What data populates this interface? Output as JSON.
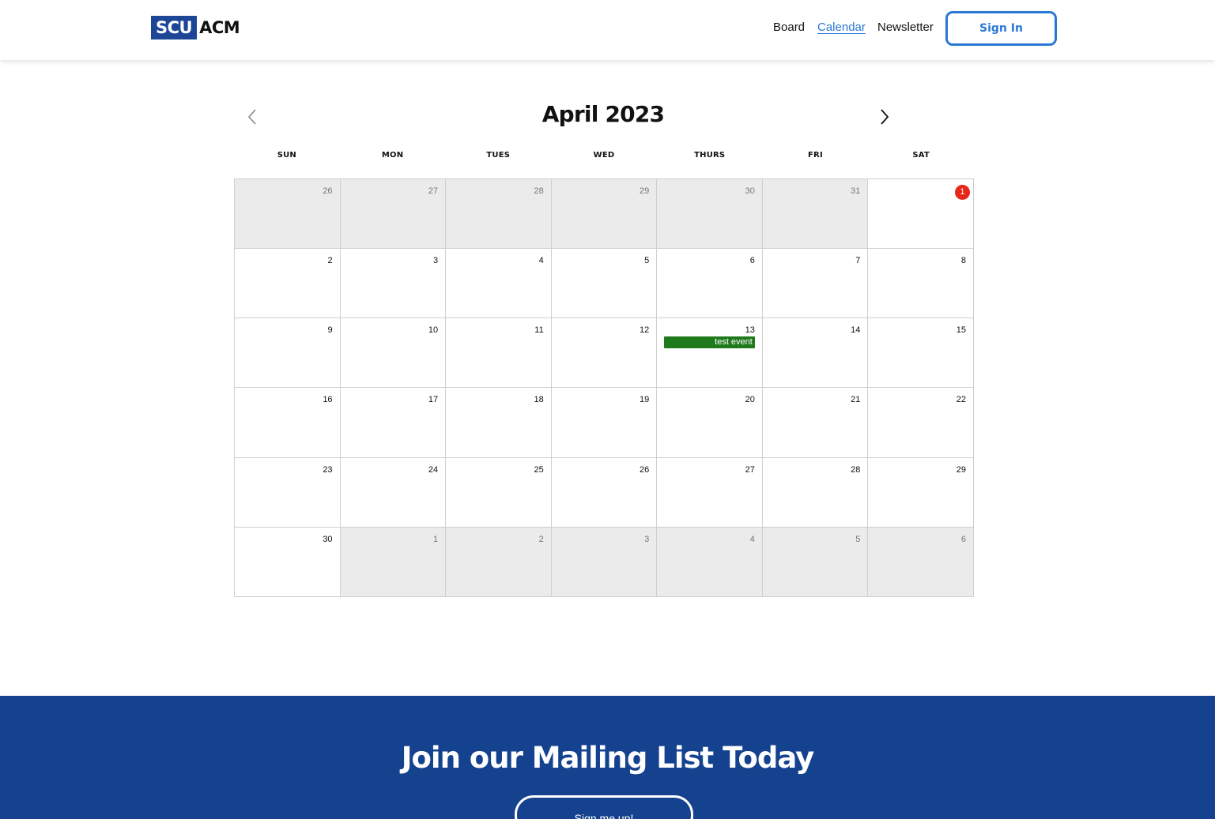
{
  "header": {
    "logo": {
      "box_text": "SCU",
      "text": "ACM"
    },
    "nav": [
      {
        "label": "Board",
        "active": false
      },
      {
        "label": "Calendar",
        "active": true
      },
      {
        "label": "Newsletter",
        "active": false
      }
    ],
    "signin_label": "Sign In"
  },
  "calendar": {
    "month_title": "April 2023",
    "prev_icon": "chevron-left-icon",
    "next_icon": "chevron-right-icon",
    "weekdays": [
      "SUN",
      "MON",
      "TUES",
      "WED",
      "THURS",
      "FRI",
      "SAT"
    ],
    "weeks": [
      [
        {
          "day": "26",
          "other": true
        },
        {
          "day": "27",
          "other": true
        },
        {
          "day": "28",
          "other": true
        },
        {
          "day": "29",
          "other": true
        },
        {
          "day": "30",
          "other": true
        },
        {
          "day": "31",
          "other": true
        },
        {
          "day": "1",
          "other": false,
          "today": true
        }
      ],
      [
        {
          "day": "2"
        },
        {
          "day": "3"
        },
        {
          "day": "4"
        },
        {
          "day": "5"
        },
        {
          "day": "6"
        },
        {
          "day": "7"
        },
        {
          "day": "8"
        }
      ],
      [
        {
          "day": "9"
        },
        {
          "day": "10"
        },
        {
          "day": "11"
        },
        {
          "day": "12"
        },
        {
          "day": "13",
          "event": "test event"
        },
        {
          "day": "14"
        },
        {
          "day": "15"
        }
      ],
      [
        {
          "day": "16"
        },
        {
          "day": "17"
        },
        {
          "day": "18"
        },
        {
          "day": "19"
        },
        {
          "day": "20"
        },
        {
          "day": "21"
        },
        {
          "day": "22"
        }
      ],
      [
        {
          "day": "23"
        },
        {
          "day": "24"
        },
        {
          "day": "25"
        },
        {
          "day": "26"
        },
        {
          "day": "27"
        },
        {
          "day": "28"
        },
        {
          "day": "29"
        }
      ],
      [
        {
          "day": "30"
        },
        {
          "day": "1",
          "other": true
        },
        {
          "day": "2",
          "other": true
        },
        {
          "day": "3",
          "other": true
        },
        {
          "day": "4",
          "other": true
        },
        {
          "day": "5",
          "other": true
        },
        {
          "day": "6",
          "other": true
        }
      ]
    ],
    "colors": {
      "today_badge": "#e8261a",
      "event": "#1f7a1c",
      "other_month_bg": "#ebebeb"
    }
  },
  "banner": {
    "title": "Join our Mailing List Today",
    "button_label": "Sign me up!",
    "background": "#15428f"
  }
}
